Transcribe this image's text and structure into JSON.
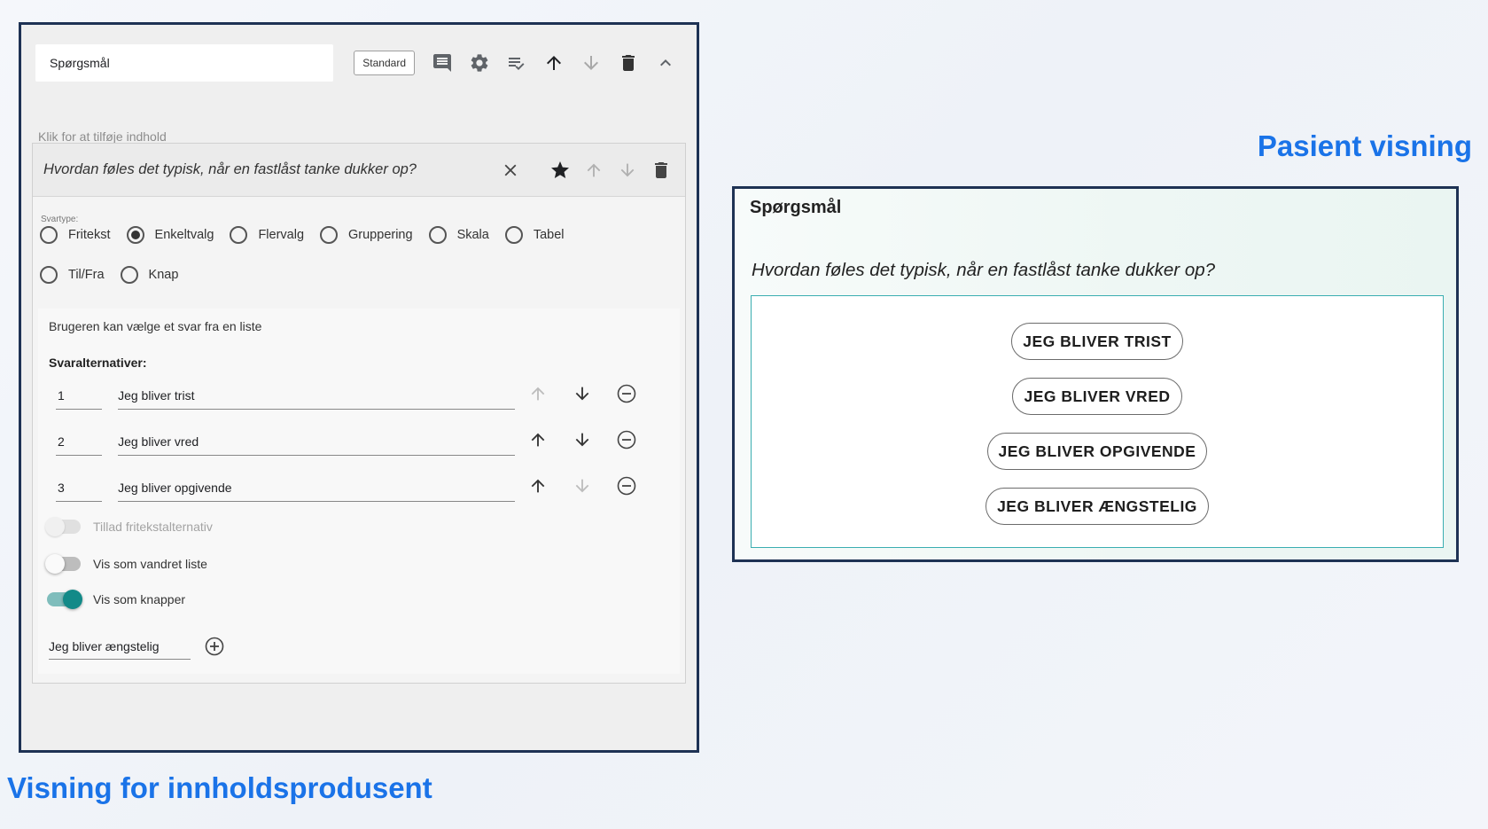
{
  "editor": {
    "title_value": "Spørgsmål",
    "standard_label": "Standard",
    "placeholder": "Klik for at tilføje indhold",
    "question_text": "Hvordan føles det typisk, når en fastlåst tanke dukker op?",
    "svartype_label": "Svartype:",
    "answer_types_row1": [
      "Fritekst",
      "Enkeltvalg",
      "Flervalg",
      "Gruppering",
      "Skala",
      "Tabel"
    ],
    "answer_types_row2": [
      "Til/Fra",
      "Knap"
    ],
    "selected_type": "Enkeltvalg",
    "panel_description": "Brugeren kan vælge et svar fra en liste",
    "options_heading": "Svaralternativer:",
    "options": [
      {
        "num": "1",
        "text": "Jeg bliver trist"
      },
      {
        "num": "2",
        "text": "Jeg bliver vred"
      },
      {
        "num": "3",
        "text": "Jeg bliver opgivende"
      }
    ],
    "toggles": [
      {
        "label": "Tillad fritekstalternativ",
        "state": "disabled-off"
      },
      {
        "label": "Vis som vandret liste",
        "state": "off"
      },
      {
        "label": "Vis som knapper",
        "state": "on"
      }
    ],
    "new_option_value": "Jeg bliver ængstelig"
  },
  "captions": {
    "left": "Visning for innholdsprodusent",
    "right": "Pasient visning"
  },
  "preview": {
    "title": "Spørgsmål",
    "question": "Hvordan føles det typisk, når en fastlåst tanke dukker op?",
    "buttons": [
      "JEG BLIVER TRIST",
      "JEG BLIVER VRED",
      "JEG BLIVER OPGIVENDE",
      "JEG BLIVER ÆNGSTELIG"
    ]
  },
  "colors": {
    "frame_border": "#1e3254",
    "caption_blue": "#1a73e8",
    "toggle_on": "#128a88",
    "answer_box_border": "#3aaeb1"
  },
  "icons": [
    "comment-icon",
    "gear-icon",
    "checklist-icon",
    "arrow-up-icon",
    "arrow-down-icon",
    "trash-icon",
    "chevron-up-icon",
    "close-icon",
    "star-icon",
    "remove-circle-icon",
    "add-circle-icon"
  ]
}
